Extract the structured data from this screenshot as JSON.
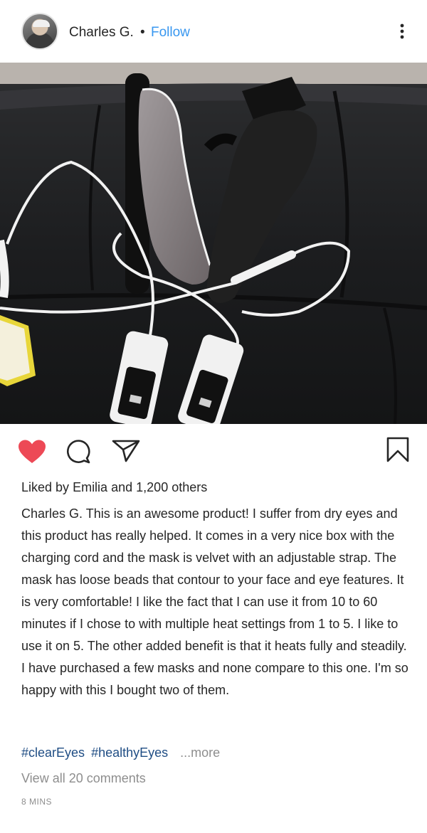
{
  "post": {
    "author": "Charles G.",
    "separator": "•",
    "follow_label": "Follow",
    "more_icon": "more-vertical-icon",
    "photo_icon": "product-photo",
    "actions": {
      "like_icon": "heart-filled-icon",
      "comment_icon": "comment-icon",
      "share_icon": "send-icon",
      "save_icon": "bookmark-icon",
      "like_color": "#ed4956"
    },
    "likes": {
      "prefix": "Liked by",
      "user": "Emilia",
      "middle": "and",
      "count": "1,200 others"
    },
    "caption": {
      "user": "Charles G.",
      "text": "This is an awesome product! I suffer from dry eyes and this product has really helped. It comes in a very nice box with the charging cord and the mask is velvet with an adjustable strap. The mask has loose beads that contour to your face and eye features. It is very comfortable! I like the fact that I can use it from 10 to 60 minutes if I chose to with multiple heat settings from 1 to 5. I like to use it on 5. The other added benefit is that it heats fully and steadily. I have purchased a few masks and none compare to this one. I'm so happy with this I bought two of them."
    },
    "hashtags": [
      "#clearEyes",
      "#healthyEyes"
    ],
    "more_label": "...more",
    "view_comments": "View all 20 comments",
    "timestamp": "8 MINS",
    "colors": {
      "link": "#3897f0",
      "hashtag": "#1f4d84",
      "muted": "#8e8e8e",
      "text": "#262626"
    }
  }
}
